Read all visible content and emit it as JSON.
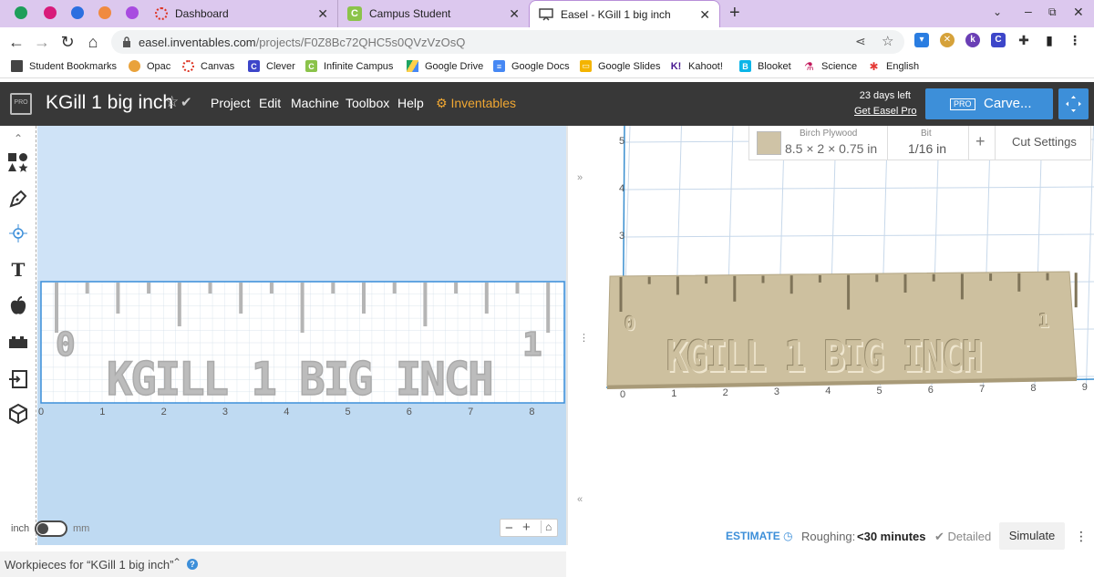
{
  "browser": {
    "tabs": [
      {
        "label": "Dashboard",
        "icon": "canvas-icon"
      },
      {
        "label": "Campus Student",
        "icon": "campus-icon"
      },
      {
        "label": "Easel - KGill 1 big inch",
        "icon": "easel-icon"
      }
    ],
    "url_domain": "easel.inventables.com",
    "url_path": "/projects/F0Z8Bc72QHC5s0QVzVzOsQ",
    "bookmarks": [
      "Student Bookmarks",
      "Opac",
      "Canvas",
      "Clever",
      "Infinite Campus",
      "Google Drive",
      "Google Docs",
      "Google Slides",
      "Kahoot!",
      "Blooket",
      "Science",
      "English"
    ]
  },
  "app": {
    "project_title": "KGill 1 big inch",
    "menu": [
      "Project",
      "Edit",
      "Machine",
      "Toolbox",
      "Help"
    ],
    "inventables_label": "Inventables",
    "trial_days": "23 days left",
    "get_pro": "Get Easel Pro",
    "pro_badge": "PRO",
    "carve_label": "Carve...",
    "logo_badge": "PRO"
  },
  "design": {
    "ruler_text": "KGILL 1 BIG INCH",
    "ruler_zero": "0",
    "ruler_one": "1",
    "x_ticks": [
      "0",
      "1",
      "2",
      "3",
      "4",
      "5",
      "6",
      "7",
      "8"
    ],
    "units_left": "inch",
    "units_right": "mm"
  },
  "preview": {
    "material_name": "Birch Plywood",
    "material_size": "8.5 × 2 × 0.75 in",
    "bit_label": "Bit",
    "bit_value": "1/16 in",
    "cut_settings": "Cut Settings",
    "y_ticks": [
      "5",
      "4",
      "3"
    ],
    "x_ticks": [
      "0",
      "1",
      "2",
      "3",
      "4",
      "5",
      "6",
      "7",
      "8",
      "9"
    ],
    "estimate": "ESTIMATE",
    "roughing_label": "Roughing:",
    "roughing_value": "<30 minutes",
    "detailed": "Detailed",
    "simulate": "Simulate"
  },
  "footer": {
    "workpieces": "Workpieces for “KGill 1 big inch”"
  },
  "colors": {
    "accent": "#3d8fd9",
    "header": "#383838",
    "tabbar": "#dcc8ee",
    "canvas": "#bfdaf2",
    "wood": "#cfc3a6",
    "inventables": "#f0a732"
  }
}
